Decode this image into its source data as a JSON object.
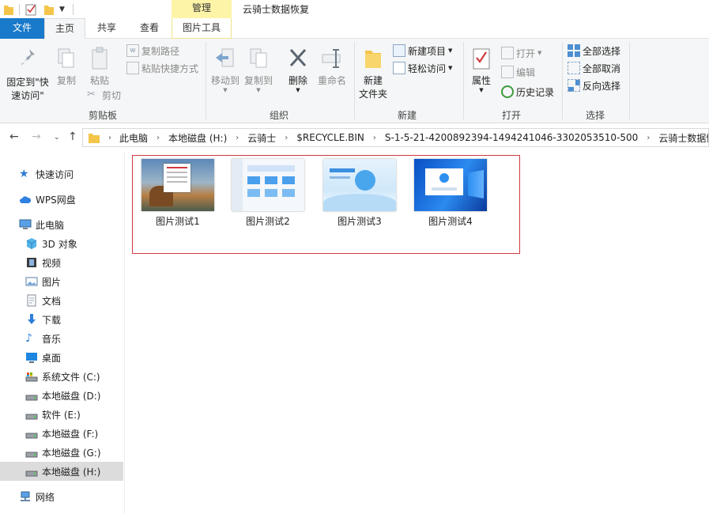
{
  "window": {
    "title": "云骑士数据恢复",
    "context_tab": "管理"
  },
  "ribbon_tabs": [
    {
      "label": "文件"
    },
    {
      "label": "主页"
    },
    {
      "label": "共享"
    },
    {
      "label": "查看"
    },
    {
      "label": "图片工具"
    }
  ],
  "ribbon": {
    "clipboard": {
      "pin_label": "固定到\"快\n速访问\"",
      "copy_label": "复制",
      "paste_label": "粘贴",
      "copy_path_label": "复制路径",
      "paste_shortcut_label": "粘贴快捷方式",
      "cut_label": "剪切",
      "group_label": "剪贴板"
    },
    "organize": {
      "move_to_label": "移动到",
      "copy_to_label": "复制到",
      "delete_label": "删除",
      "rename_label": "重命名",
      "group_label": "组织"
    },
    "new": {
      "new_folder_label": "新建\n文件夹",
      "new_item_label": "新建项目",
      "easy_access_label": "轻松访问",
      "group_label": "新建"
    },
    "open": {
      "properties_label": "属性",
      "open_label": "打开",
      "edit_label": "编辑",
      "history_label": "历史记录",
      "group_label": "打开"
    },
    "select": {
      "select_all_label": "全部选择",
      "select_none_label": "全部取消",
      "invert_label": "反向选择",
      "group_label": "选择"
    }
  },
  "address": {
    "crumbs": [
      "此电脑",
      "本地磁盘 (H:)",
      "云骑士",
      "$RECYCLE.BIN",
      "S-1-5-21-4200892394-1494241046-3302053510-500",
      "云骑士数据恢复"
    ]
  },
  "sidebar": {
    "items": [
      {
        "label": "快速访问",
        "icon": "star-icon"
      },
      {
        "label": "WPS网盘",
        "icon": "cloud-icon"
      },
      {
        "label": "此电脑",
        "icon": "computer-icon"
      },
      {
        "label": "3D 对象",
        "icon": "cube-icon"
      },
      {
        "label": "视频",
        "icon": "video-icon"
      },
      {
        "label": "图片",
        "icon": "picture-icon"
      },
      {
        "label": "文档",
        "icon": "document-icon"
      },
      {
        "label": "下载",
        "icon": "download-icon"
      },
      {
        "label": "音乐",
        "icon": "music-icon"
      },
      {
        "label": "桌面",
        "icon": "desktop-icon"
      },
      {
        "label": "系统文件 (C:)",
        "icon": "drive-icon"
      },
      {
        "label": "本地磁盘 (D:)",
        "icon": "drive-icon"
      },
      {
        "label": "软件 (E:)",
        "icon": "drive-icon"
      },
      {
        "label": "本地磁盘 (F:)",
        "icon": "drive-icon"
      },
      {
        "label": "本地磁盘 (G:)",
        "icon": "drive-icon"
      },
      {
        "label": "本地磁盘 (H:)",
        "icon": "drive-icon",
        "selected": true
      },
      {
        "label": "网络",
        "icon": "network-icon"
      }
    ]
  },
  "files": [
    {
      "name": "图片测试1"
    },
    {
      "name": "图片测试2"
    },
    {
      "name": "图片测试3"
    },
    {
      "name": "图片测试4"
    }
  ],
  "colors": {
    "file_tab": "#1979ca",
    "manage_tab": "#fdf4a8",
    "highlight_border": "#d0393e",
    "selected_nav": "#dcdcdc"
  }
}
